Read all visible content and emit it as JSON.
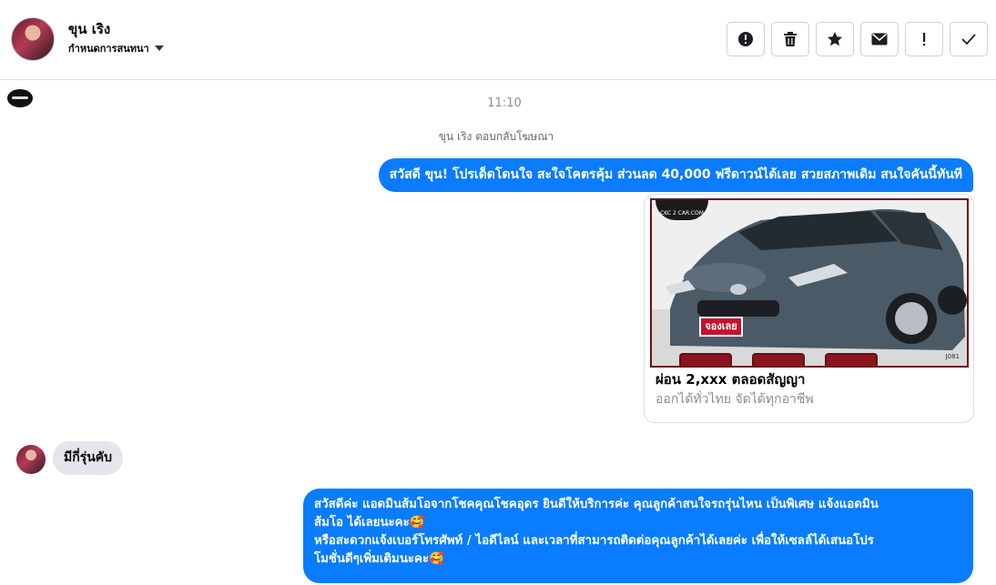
{
  "header": {
    "contact_name": "ขุน เริง",
    "conversation_settings": "กำหนดการสนทนา",
    "actions": [
      {
        "name": "report-button",
        "icon": "alert-circle-icon"
      },
      {
        "name": "delete-button",
        "icon": "trash-icon"
      },
      {
        "name": "star-button",
        "icon": "star-icon"
      },
      {
        "name": "mark-unread-button",
        "icon": "envelope-icon"
      },
      {
        "name": "flag-button",
        "icon": "exclamation-icon"
      },
      {
        "name": "mark-done-button",
        "icon": "check-icon"
      }
    ]
  },
  "thread": {
    "timestamp": "11:10",
    "reply_note": "ขุน เริง ตอบกลับโฆษณา",
    "messages": [
      {
        "direction": "outgoing",
        "text": "สวัสดี ขุน! โปรเด็ดโดนใจ สะใจโคตรคุ้ม ส่วนลด 40,000 ฟรีดาวน์ได้เลย สวยสภาพเดิม สนใจคันนี้ทันที"
      },
      {
        "direction": "incoming",
        "text": "มีกี่รุ่นคับ"
      },
      {
        "direction": "outgoing",
        "lines": [
          "สวัสดีค่ะ แอดมินส้มโอจากโชคคุณโชคอุดร ยินดีให้บริการค่ะ   คุณลูกค้าสนใจรถรุ่นไหน เป็นพิเศษ แจ้งแอดมิน",
          "ส้มโอ ได้เลยนะคะ🥰",
          "หรือสะดวกแจ้งเบอร์โทรศัพท์ / ไอดีไลน์ และเวลาที่สามารถติดต่อคุณลูกค้าได้เลยค่ะ เพื่อให้เซลล์ได้เสนอโปร",
          "โมชั่นดีๆเพิ่มเติมนะคะ🥰"
        ]
      }
    ],
    "ad_card": {
      "logo_text": "CKC 2 CAR.COM",
      "badge": "จองเลย",
      "code": "J081",
      "title": "ผ่อน 2,xxx ตลอดสัญญา",
      "subtitle": "ออกได้ทั่วไทย จัดได้ทุกอาชีพ"
    }
  },
  "colors": {
    "accent": "#0a7cff",
    "incoming_bubble": "#e4e6eb",
    "border": "#dadde1",
    "muted_text": "#8a8d91"
  }
}
